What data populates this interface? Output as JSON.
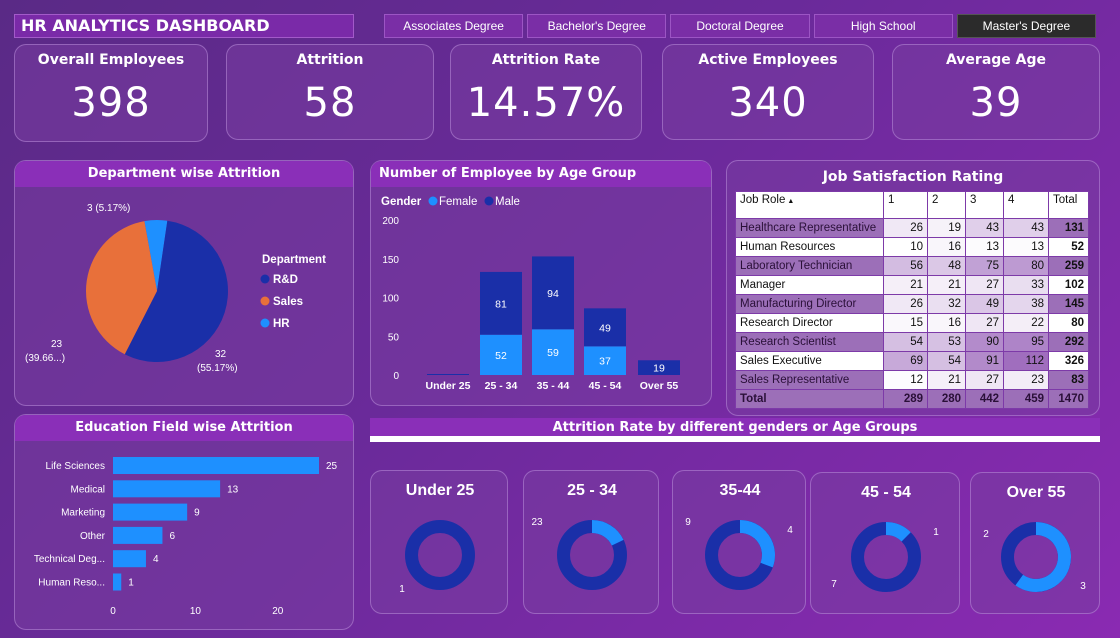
{
  "dashboard": {
    "title": "HR ANALYTICS DASHBOARD"
  },
  "education_slicer": {
    "options": [
      "Associates Degree",
      "Bachelor's Degree",
      "Doctoral Degree",
      "High School",
      "Master's Degree"
    ],
    "selected": "Master's Degree"
  },
  "kpis": {
    "overall_employees": {
      "label": "Overall Employees",
      "value": "398"
    },
    "attrition": {
      "label": "Attrition",
      "value": "58"
    },
    "attrition_rate": {
      "label": "Attrition Rate",
      "value": "14.57%"
    },
    "active_employees": {
      "label": "Active Employees",
      "value": "340"
    },
    "average_age": {
      "label": "Average Age",
      "value": "39"
    }
  },
  "panels": {
    "department_attrition": "Department wise Attrition",
    "age_group": "Number of Employee by Age Group",
    "job_satisfaction": "Job Satisfaction Rating",
    "education_field": "Education Field wise Attrition",
    "attrition_rate_groups": "Attrition Rate by different genders or Age Groups"
  },
  "colors": {
    "navy": "#1a2fa8",
    "blue": "#1e90ff",
    "orange": "#e8703a",
    "panel_title": "#8a2fb8"
  },
  "chart_data": [
    {
      "id": "department_pie",
      "type": "pie",
      "title": "Department wise Attrition",
      "legend_title": "Department",
      "legend_position": "right",
      "slices": [
        {
          "label": "R&D",
          "value": 32,
          "data_label": "32\n(55.17%)",
          "color": "#1a2fa8"
        },
        {
          "label": "Sales",
          "value": 23,
          "data_label": "23\n(39.66...)",
          "color": "#e8703a"
        },
        {
          "label": "HR",
          "value": 3,
          "data_label": "3 (5.17%)",
          "color": "#1e90ff"
        }
      ]
    },
    {
      "id": "age_group_stacked",
      "type": "bar",
      "title": "Number of Employee by Age Group",
      "legend_title": "Gender",
      "legend_position": "top-left",
      "categories": [
        "Under 25",
        "25 - 34",
        "35 - 44",
        "45 - 54",
        "Over 55"
      ],
      "series": [
        {
          "name": "Female",
          "values": [
            0,
            52,
            59,
            37,
            0
          ],
          "color": "#1e90ff"
        },
        {
          "name": "Male",
          "values": [
            1,
            81,
            94,
            49,
            19
          ],
          "color": "#1a2fa8"
        }
      ],
      "yticks": [
        0,
        50,
        100,
        150,
        200
      ],
      "ylim": [
        0,
        200
      ],
      "grid": false
    },
    {
      "id": "education_field_bar",
      "type": "bar",
      "orientation": "horizontal",
      "title": "Education Field wise Attrition",
      "categories": [
        "Life Sciences",
        "Medical",
        "Marketing",
        "Other",
        "Technical Deg...",
        "Human Reso..."
      ],
      "values": [
        25,
        13,
        9,
        6,
        4,
        1
      ],
      "xticks": [
        0,
        10,
        20
      ],
      "xlim": [
        0,
        26.5
      ],
      "color": "#1e90ff"
    },
    {
      "id": "age_donuts",
      "type": "pie",
      "title": "Attrition Rate by different genders or Age Groups",
      "groups": [
        {
          "label": "Under 25",
          "values": [
            1,
            0
          ],
          "labels": [
            "1",
            ""
          ]
        },
        {
          "label": "25 - 34",
          "values": [
            23,
            5
          ],
          "labels": [
            "23",
            ""
          ]
        },
        {
          "label": "35-44",
          "values": [
            9,
            4
          ],
          "labels": [
            "9",
            "4"
          ]
        },
        {
          "label": "45 - 54",
          "values": [
            7,
            1
          ],
          "labels": [
            "7",
            "1"
          ]
        },
        {
          "label": "Over 55",
          "values": [
            2,
            3
          ],
          "labels": [
            "2",
            "3"
          ]
        }
      ]
    },
    {
      "id": "job_satisfaction_table",
      "type": "table",
      "title": "Job Satisfaction Rating",
      "columns": [
        "Job Role",
        "1",
        "2",
        "3",
        "4",
        "Total"
      ],
      "rows": [
        [
          "Healthcare Representative",
          "26",
          "19",
          "43",
          "43",
          "131"
        ],
        [
          "Human Resources",
          "10",
          "16",
          "13",
          "13",
          "52"
        ],
        [
          "Laboratory Technician",
          "56",
          "48",
          "75",
          "80",
          "259"
        ],
        [
          "Manager",
          "21",
          "21",
          "27",
          "33",
          "102"
        ],
        [
          "Manufacturing Director",
          "26",
          "32",
          "49",
          "38",
          "145"
        ],
        [
          "Research Director",
          "15",
          "16",
          "27",
          "22",
          "80"
        ],
        [
          "Research Scientist",
          "54",
          "53",
          "90",
          "95",
          "292"
        ],
        [
          "Sales Executive",
          "69",
          "54",
          "91",
          "112",
          "326"
        ],
        [
          "Sales Representative",
          "12",
          "21",
          "27",
          "23",
          "83"
        ]
      ],
      "total_row": [
        "Total",
        "289",
        "280",
        "442",
        "459",
        "1470"
      ]
    }
  ]
}
